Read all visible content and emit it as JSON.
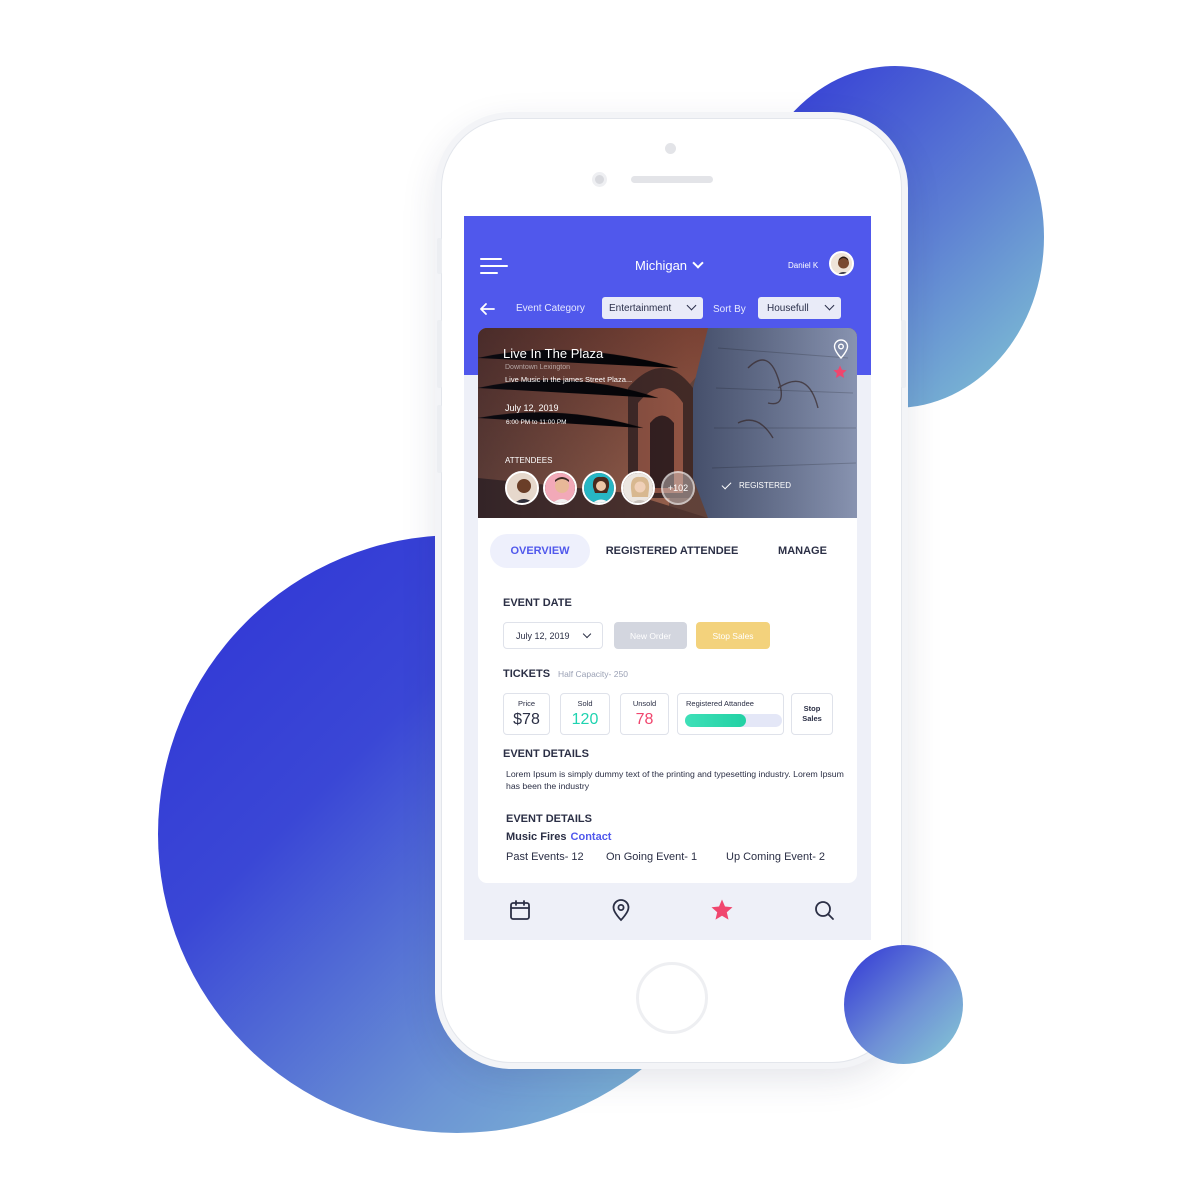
{
  "header": {
    "location": "Michigan",
    "user_name": "Daniel K"
  },
  "filters": {
    "category_label": "Event Category",
    "category_value": "Entertainment",
    "sort_label": "Sort By",
    "sort_value": "Housefull"
  },
  "event": {
    "title": "Live In The Plaza",
    "location": "Downtown Lexington",
    "description": "Live Music in the james Street Plaza...",
    "date": "July 12, 2019",
    "time": "6:00 PM to 11:00 PM",
    "attendees_label": "ATTENDEES",
    "more_attendees": "+102",
    "registered_label": "REGISTERED"
  },
  "tabs": [
    {
      "label": "OVERVIEW",
      "active": true
    },
    {
      "label": "REGISTERED ATTENDEE",
      "active": false
    },
    {
      "label": "MANAGE",
      "active": false
    }
  ],
  "event_date": {
    "title": "EVENT DATE",
    "selected": "July 12, 2019",
    "new_order": "New Order",
    "stop_sales": "Stop Sales"
  },
  "tickets": {
    "title": "TICKETS",
    "capacity": "Half Capacity- 250",
    "price_label": "Price",
    "price_value": "$78",
    "sold_label": "Sold",
    "sold_value": "120",
    "unsold_label": "Unsold",
    "unsold_value": "78",
    "registered_label": "Registered Attandee",
    "registered_progress": 0.63,
    "stop_label_1": "Stop",
    "stop_label_2": "Sales"
  },
  "event_details": {
    "title": "EVENT DETAILS",
    "text": "Lorem Ipsum is simply dummy text of the printing and typesetting industry. Lorem Ipsum has been the industry"
  },
  "organizer": {
    "title": "EVENT DETAILS",
    "name": "Music Fires",
    "contact": "Contact",
    "past": "Past Events- 12",
    "ongoing": "On Going Event- 1",
    "upcoming": "Up Coming Event- 2"
  },
  "bottom_nav": [
    "calendar-icon",
    "location-pin-icon",
    "star-icon",
    "search-icon"
  ],
  "colors": {
    "accent": "#5058ec",
    "sold": "#1fd3b0",
    "unsold": "#f0466e",
    "favorite": "#f0466e",
    "stop_sales": "#f3d27c",
    "new_order": "#d3d6df"
  }
}
